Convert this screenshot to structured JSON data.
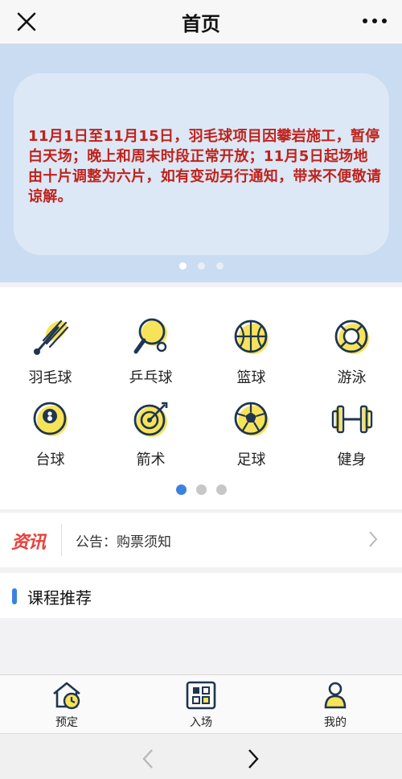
{
  "header": {
    "title": "首页"
  },
  "banner": {
    "text": "11月1日至11月15日，羽毛球项目因攀岩施工，暂停白天场；晚上和周末时段正常开放；11月5日起场地由十片调整为六片，如有变动另行通知，带来不便敬请谅解。",
    "slide_count": 3,
    "active_slide": 1
  },
  "categories": [
    {
      "label": "羽毛球",
      "icon": "badminton-icon"
    },
    {
      "label": "乒乓球",
      "icon": "ping-pong-icon"
    },
    {
      "label": "篮球",
      "icon": "basketball-icon"
    },
    {
      "label": "游泳",
      "icon": "swimming-icon"
    },
    {
      "label": "台球",
      "icon": "billiards-icon"
    },
    {
      "label": "箭术",
      "icon": "archery-icon"
    },
    {
      "label": "足球",
      "icon": "football-icon"
    },
    {
      "label": "健身",
      "icon": "fitness-icon"
    }
  ],
  "category_pages": {
    "count": 3,
    "active": 1
  },
  "news": {
    "logo": "资讯",
    "notice": "公告：购票须知"
  },
  "course": {
    "title": "课程推荐"
  },
  "tabbar": [
    {
      "label": "预定",
      "icon": "booking-icon"
    },
    {
      "label": "入场",
      "icon": "qr-entry-icon"
    },
    {
      "label": "我的",
      "icon": "profile-icon"
    }
  ],
  "colors": {
    "accent": "#3b82e0",
    "banner_text": "#c0221b",
    "icon_yellow": "#f7e35a",
    "icon_navy": "#1f3550"
  }
}
